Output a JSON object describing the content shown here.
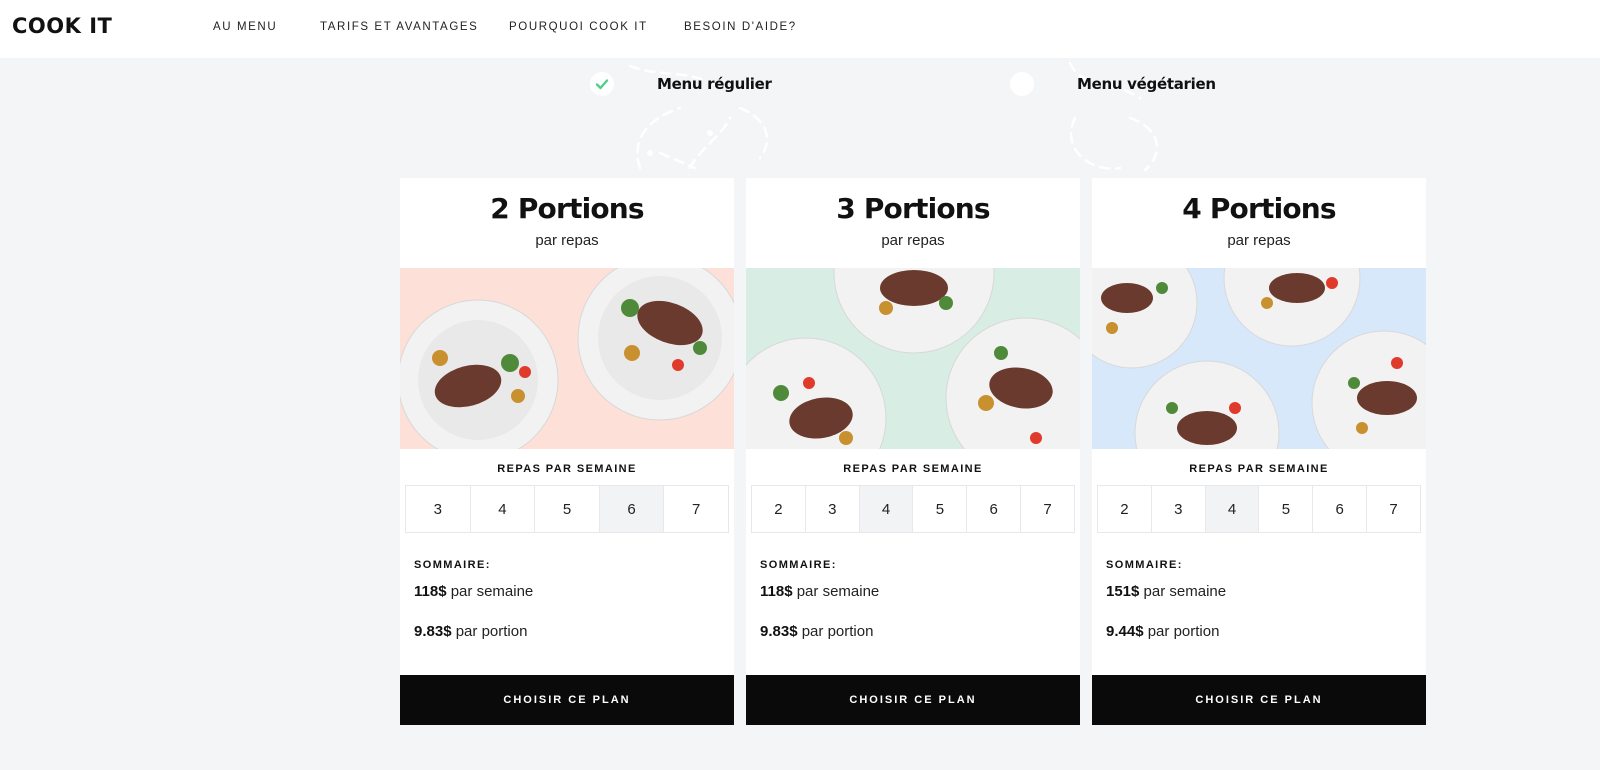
{
  "header": {
    "logo": "COOK IT",
    "nav": [
      "AU MENU",
      "TARIFS ET AVANTAGES",
      "POURQUOI COOK IT",
      "BESOIN D'AIDE?"
    ]
  },
  "menu_toggle": {
    "regular": {
      "label": "Menu régulier",
      "selected": true
    },
    "vegetarian": {
      "label": "Menu végétarien",
      "selected": false
    }
  },
  "cards": [
    {
      "title": "2 Portions",
      "subtitle": "par repas",
      "image_bg": "#fde0d8",
      "repas_label": "REPAS PAR SEMAINE",
      "options": [
        "3",
        "4",
        "5",
        "6",
        "7"
      ],
      "selected": "6",
      "sommaire_label": "SOMMAIRE:",
      "weekly_price": "118$",
      "weekly_suffix": "par semaine",
      "portion_price": "9.83$",
      "portion_suffix": "par portion",
      "cta": "CHOISIR CE PLAN"
    },
    {
      "title": "3 Portions",
      "subtitle": "par repas",
      "image_bg": "#d8ede3",
      "repas_label": "REPAS PAR SEMAINE",
      "options": [
        "2",
        "3",
        "4",
        "5",
        "6",
        "7"
      ],
      "selected": "4",
      "sommaire_label": "SOMMAIRE:",
      "weekly_price": "118$",
      "weekly_suffix": "par semaine",
      "portion_price": "9.83$",
      "portion_suffix": "par portion",
      "cta": "CHOISIR CE PLAN"
    },
    {
      "title": "4 Portions",
      "subtitle": "par repas",
      "image_bg": "#d7e8fa",
      "repas_label": "REPAS PAR SEMAINE",
      "options": [
        "2",
        "3",
        "4",
        "5",
        "6",
        "7"
      ],
      "selected": "4",
      "sommaire_label": "SOMMAIRE:",
      "weekly_price": "151$",
      "weekly_suffix": "par semaine",
      "portion_price": "9.44$",
      "portion_suffix": "par portion",
      "cta": "CHOISIR CE PLAN"
    }
  ],
  "colors": {
    "page_bg": "#f4f5f7",
    "cta_bg": "#0a0a0a",
    "check": "#4cd18b"
  }
}
